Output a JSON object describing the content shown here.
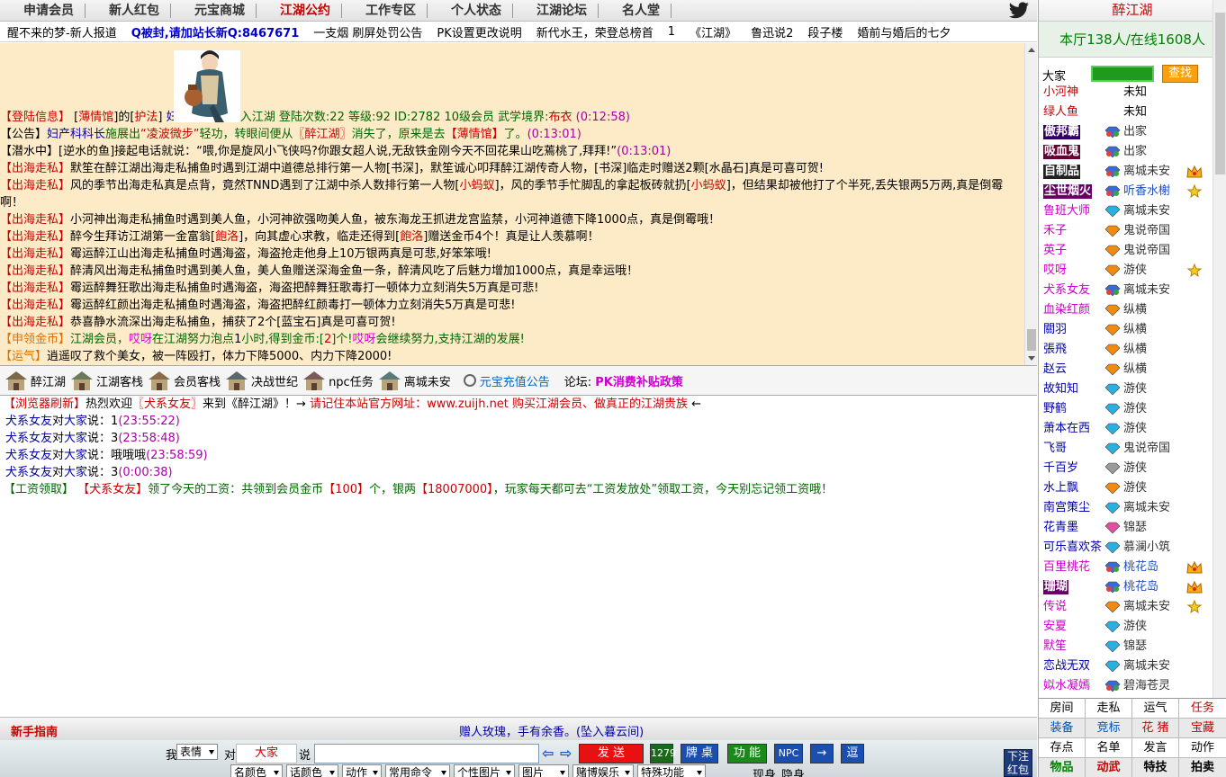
{
  "nav": {
    "items": [
      "申请会员",
      "新人红包",
      "元宝商城",
      "江湖公约",
      "工作专区",
      "个人状态",
      "江湖论坛",
      "名人堂"
    ],
    "active_index": 3
  },
  "marquee": [
    "醒不来的梦-新人报道",
    "Q被封,请加站长新Q:8467671",
    "一支烟 刷屏处罚公告",
    "PK设置更改说明",
    "新代水王，荣登总榜首",
    "1",
    "《江湖》",
    "鲁迅说2",
    "段子楼",
    "婚前与婚后的七夕"
  ],
  "public_chat": [
    [
      [
        "【登陆信息】",
        "red"
      ],
      [
        " [",
        ""
      ],
      [
        "薄情馆",
        "red"
      ],
      [
        "]的[",
        ""
      ],
      [
        "护法",
        "red"
      ],
      [
        "]",
        ""
      ],
      [
        "            ",
        ""
      ],
      [
        "妇产科科长",
        "blue"
      ],
      [
        " 杀入江湖 登陆次数:22 等级:92 ID:2782 10级会员 武学境界:",
        "green"
      ],
      [
        "布衣",
        "dred"
      ],
      [
        " (0:12:58)",
        "purple"
      ]
    ],
    [
      [
        "【公告】",
        ""
      ],
      [
        "妇产科科长",
        "blue"
      ],
      [
        "施展出",
        "green"
      ],
      [
        "“凌波微步”",
        "red"
      ],
      [
        "轻功，转眼间便从",
        "green"
      ],
      [
        "〖醉江湖〗",
        "red"
      ],
      [
        "消失了，原来是去",
        "green"
      ],
      [
        "【薄情馆】",
        "red"
      ],
      [
        "了。",
        "green"
      ],
      [
        "(0:13:01)",
        "purple"
      ]
    ],
    [
      [
        "【潜水中】[逆水的鱼]接起电话就说：“喂,你是旋风小飞侠吗?你跟女超人说,无敌铁金刚今天不回花果山吃蔫桃了,拜拜!”",
        ""
      ],
      [
        "(0:13:01)",
        "purple"
      ]
    ],
    [
      [
        "【出海走私】",
        "red"
      ],
      [
        "默笙在醉江湖出海走私捕鱼时遇到江湖中道德总排行第一人物[书深]，默笙诚心叩拜醉江湖传奇人物，[书深]临走时赠送2颗[水晶石]真是可喜可贺!",
        ""
      ]
    ],
    [
      [
        "【出海走私】",
        "red"
      ],
      [
        "风的季节出海走私真是点背，竟然TNND遇到了江湖中杀人数排行第一人物[",
        ""
      ],
      [
        "小蚂蚁",
        "red"
      ],
      [
        "]，风的季节手忙脚乱的拿起板砖就扔[",
        ""
      ],
      [
        "小蚂蚁",
        "red"
      ],
      [
        "]，但结果却被他打了个半死,丢失银两5万两,真是倒霉啊！",
        ""
      ]
    ],
    [
      [
        "【出海走私】",
        "red"
      ],
      [
        "小河神出海走私捕鱼时遇到美人鱼，小河神欲强吻美人鱼，被东海龙王抓进龙宫监禁，小河神道德下降1000点，真是倒霉哦！",
        ""
      ]
    ],
    [
      [
        "【出海走私】",
        "red"
      ],
      [
        "醉今生拜访江湖第一金富翁[",
        ""
      ],
      [
        "飽洛",
        "red"
      ],
      [
        "]，向其虚心求教，临走还得到[",
        ""
      ],
      [
        "飽洛",
        "red"
      ],
      [
        "]赠送金币4个！真是让人羡慕啊！",
        ""
      ]
    ],
    [
      [
        "【出海走私】",
        "red"
      ],
      [
        "霉运醉江山出海走私捕鱼时遇海盗，海盗抢走他身上10万银两真是可悲,好笨笨哦!",
        ""
      ]
    ],
    [
      [
        "【出海走私】",
        "red"
      ],
      [
        "醉清风出海走私捕鱼时遇到美人鱼，美人鱼赠送深海金鱼一条，醉清风吃了后魅力增加1000点，真是幸运哦！",
        ""
      ]
    ],
    [
      [
        "【出海走私】",
        "red"
      ],
      [
        "霉运醉舞狂歌出海走私捕鱼时遇海盗，海盗把醉舞狂歌毒打一顿体力立刻消失5万真是可悲!",
        ""
      ]
    ],
    [
      [
        "【出海走私】",
        "red"
      ],
      [
        "霉运醉红颜出海走私捕鱼时遇海盗，海盗把醉红颜毒打一顿体力立刻消失5万真是可悲!",
        ""
      ]
    ],
    [
      [
        "【出海走私】",
        "red"
      ],
      [
        "恭喜静水流深出海走私捕鱼，捕获了2个[蓝宝石]真是可喜可贺!",
        ""
      ]
    ],
    [
      [
        "【申领金币】",
        "orange"
      ],
      [
        "江湖会员，",
        "green"
      ],
      [
        "哎呀",
        "magenta"
      ],
      [
        "在江湖努力泡点",
        "green"
      ],
      [
        "1",
        ""
      ],
      [
        "小时,得到金币:[",
        "green"
      ],
      [
        "2",
        "red"
      ],
      [
        "]个!",
        "green"
      ],
      [
        "哎呀",
        "magenta"
      ],
      [
        "会继续努力,支持江湖的发展!",
        "green"
      ]
    ],
    [
      [
        "【运气】",
        "orange"
      ],
      [
        "逍遥叹了救个美女，被一阵殴打，体力下降5000、内力下降2000!",
        ""
      ]
    ]
  ],
  "rooms": [
    "醉江湖",
    "江湖客栈",
    "会员客栈",
    "决战世纪",
    "npc任务",
    "离城未安"
  ],
  "recharge": "元宝充值公告",
  "forum": {
    "label": "论坛:",
    "link": "PK消费补贴政策"
  },
  "private_chat": [
    [
      [
        "【浏览器刷新】",
        "red"
      ],
      [
        "热烈欢迎",
        ""
      ],
      [
        "〖犬系女友〗",
        "red"
      ],
      [
        "来到《醉江湖》！→ ",
        ""
      ],
      [
        "请记住本站官方网址：www.zuijh.net 购买江湖会员、做真正的江湖贵族",
        "red"
      ],
      [
        " ←",
        ""
      ]
    ],
    [
      [
        "犬系女友",
        "blue"
      ],
      [
        "对",
        ""
      ],
      [
        "大家",
        "blue"
      ],
      [
        "说：1",
        ""
      ],
      [
        "(23:55:22)",
        "purple"
      ]
    ],
    [
      [
        "犬系女友",
        "blue"
      ],
      [
        "对",
        ""
      ],
      [
        "大家",
        "blue"
      ],
      [
        "说：3",
        ""
      ],
      [
        "(23:58:48)",
        "purple"
      ]
    ],
    [
      [
        "犬系女友",
        "blue"
      ],
      [
        "对",
        ""
      ],
      [
        "大家",
        "blue"
      ],
      [
        "说：哦哦哦",
        ""
      ],
      [
        "(23:58:59)",
        "purple"
      ]
    ],
    [
      [
        "犬系女友",
        "blue"
      ],
      [
        "对",
        ""
      ],
      [
        "大家",
        "blue"
      ],
      [
        "说：3",
        ""
      ],
      [
        "(0:00:38)",
        "purple"
      ]
    ],
    [
      [
        "【工资领取】",
        "green"
      ],
      [
        " 【犬系女友】",
        "red"
      ],
      [
        "领了今天的工资：共领到会员金币",
        "green"
      ],
      [
        "【100】",
        "red"
      ],
      [
        "个，银两",
        "green"
      ],
      [
        "【18007000】",
        "red"
      ],
      [
        "，玩家每天都可去“工资发放处”领取工资，今天别忘记领工资哦！",
        "green"
      ]
    ]
  ],
  "bottom": {
    "guide": "新手指南",
    "gift": "赠人玫瑰，手有余香。(坠入暮云间)",
    "me_label": "我",
    "expr": "表情",
    "to_label": "对",
    "target": "大家",
    "say_label": "说",
    "send": "发 送",
    "count": "1279",
    "buttons": [
      "牌 桌",
      "功 能",
      "NPC",
      "→",
      "逗"
    ],
    "selects": [
      "名颜色",
      "话颜色",
      "动作",
      "常用命令",
      "个性图片",
      "图片",
      "赌博娱乐",
      "特殊功能"
    ],
    "checks": [
      "现身",
      "隐身"
    ],
    "side_btn": [
      "下注",
      "红包"
    ]
  },
  "right": {
    "title": "醉江湖",
    "stats": "本厅138人/在线1608人",
    "search_label": "大家",
    "find": "查找",
    "users": [
      {
        "name": "小河神",
        "nc": "#cc0000",
        "title": "未知",
        "icon": "none",
        "badge": ""
      },
      {
        "name": "绿人鱼",
        "nc": "#cc0000",
        "title": "未知",
        "icon": "none",
        "badge": ""
      },
      {
        "name": "傲邦霸",
        "nc": "#ffffff",
        "nbg": "#330066",
        "title": "出家",
        "icon": "gem",
        "badge": ""
      },
      {
        "name": "吸血鬼",
        "nc": "#ffffff",
        "nbg": "#660033",
        "title": "出家",
        "icon": "gem",
        "badge": ""
      },
      {
        "name": "自制品",
        "nc": "#ffffff",
        "nbg": "#222222",
        "title": "离城未安",
        "icon": "gem",
        "badge": "crown"
      },
      {
        "name": "尘世烟火",
        "nc": "#ffffff",
        "nbg": "#660066",
        "title": "听香水榭",
        "icon": "gem",
        "badge": "star"
      },
      {
        "name": "鲁班大师",
        "nc": "#cc00cc",
        "title": "离城未安",
        "icon": "diamond",
        "badge": ""
      },
      {
        "name": "禾子",
        "nc": "#cc00cc",
        "title": "鬼说帝国",
        "icon": "orange",
        "badge": ""
      },
      {
        "name": "英子",
        "nc": "#cc00cc",
        "title": "鬼说帝国",
        "icon": "orange",
        "badge": ""
      },
      {
        "name": "哎呀",
        "nc": "#cc00cc",
        "title": "游侠",
        "icon": "orange",
        "badge": "star2"
      },
      {
        "name": "犬系女友",
        "nc": "#cc00cc",
        "title": "离城未安",
        "icon": "gem",
        "badge": ""
      },
      {
        "name": "血染红颜",
        "nc": "#cc00cc",
        "title": "纵横",
        "icon": "orange",
        "badge": ""
      },
      {
        "name": "關羽",
        "nc": "#0000aa",
        "title": "纵横",
        "icon": "orange",
        "badge": ""
      },
      {
        "name": "張飛",
        "nc": "#0000aa",
        "title": "纵横",
        "icon": "orange",
        "badge": ""
      },
      {
        "name": "赵云",
        "nc": "#0000aa",
        "title": "纵横",
        "icon": "orange",
        "badge": ""
      },
      {
        "name": "故知知",
        "nc": "#0000aa",
        "title": "游侠",
        "icon": "diamond",
        "badge": ""
      },
      {
        "name": "野鹤",
        "nc": "#0000aa",
        "title": "游侠",
        "icon": "diamond",
        "badge": ""
      },
      {
        "name": "萧本在西",
        "nc": "#0000aa",
        "title": "游侠",
        "icon": "diamond",
        "badge": ""
      },
      {
        "name": "飞哥",
        "nc": "#0000aa",
        "title": "鬼说帝国",
        "icon": "diamond",
        "badge": ""
      },
      {
        "name": "千百岁",
        "nc": "#0000aa",
        "title": "游侠",
        "icon": "grey",
        "badge": ""
      },
      {
        "name": "水上飘",
        "nc": "#0000aa",
        "title": "游侠",
        "icon": "orange",
        "badge": ""
      },
      {
        "name": "南宫策尘",
        "nc": "#0000aa",
        "title": "离城未安",
        "icon": "diamond",
        "badge": ""
      },
      {
        "name": "花青墨",
        "nc": "#0000aa",
        "title": "锦瑟",
        "icon": "pink",
        "badge": ""
      },
      {
        "name": "可乐喜欢茶",
        "nc": "#0000aa",
        "title": "慕澜小筑",
        "icon": "diamond",
        "badge": ""
      },
      {
        "name": "百里桃花",
        "nc": "#cc00cc",
        "title": "桃花岛",
        "icon": "gem",
        "badge": "crown"
      },
      {
        "name": "珊瑚",
        "nc": "#ffffff",
        "nbg": "#660066",
        "title": "桃花岛",
        "icon": "gem",
        "badge": "crown"
      },
      {
        "name": "传说",
        "nc": "#cc00cc",
        "title": "离城未安",
        "icon": "orange",
        "badge": "star1"
      },
      {
        "name": "安夏",
        "nc": "#cc00cc",
        "title": "游侠",
        "icon": "diamond",
        "badge": ""
      },
      {
        "name": "默笙",
        "nc": "#cc00cc",
        "title": "锦瑟",
        "icon": "diamond",
        "badge": ""
      },
      {
        "name": "恋战无双",
        "nc": "#0000aa",
        "title": "离城未安",
        "icon": "diamond",
        "badge": ""
      },
      {
        "name": "姒水凝嫣",
        "nc": "#cc00cc",
        "title": "碧海苍灵",
        "icon": "gem",
        "badge": ""
      }
    ],
    "tabs": [
      [
        "房间",
        "走私",
        "运气",
        "任务"
      ],
      [
        "装备",
        "竞标",
        "花 猪",
        "宝藏"
      ],
      [
        "存点",
        "名单",
        "发言",
        "动作"
      ],
      [
        "物品",
        "动武",
        "特技",
        "拍卖"
      ]
    ]
  }
}
